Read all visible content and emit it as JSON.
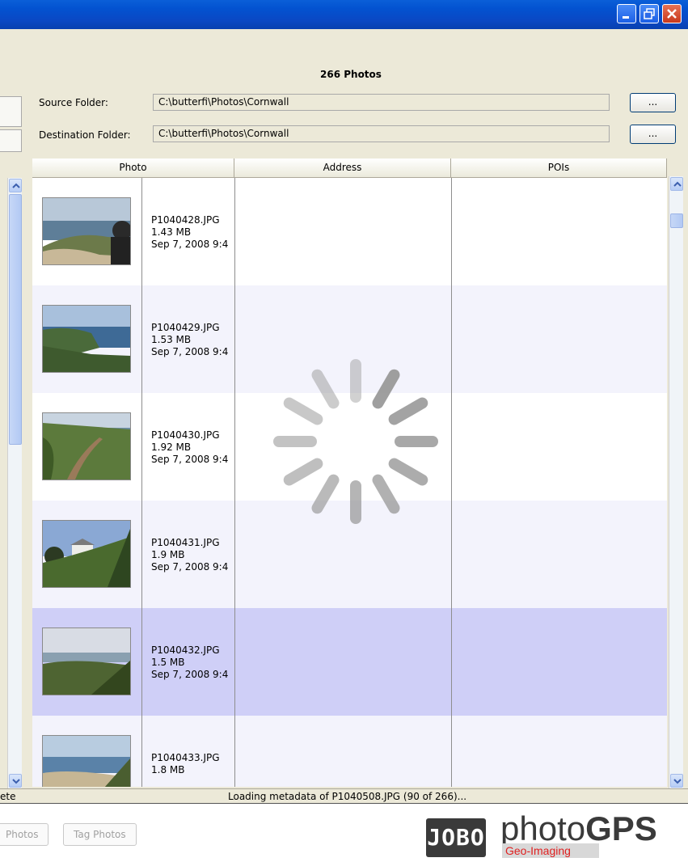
{
  "window": {
    "buttons": [
      "minimize",
      "restore",
      "close"
    ]
  },
  "photo_count": "266 Photos",
  "source": {
    "label": "Source Folder:",
    "value": "C:\\butterfi\\Photos\\Cornwall",
    "browse": "..."
  },
  "destination": {
    "label": "Destination Folder:",
    "value": "C:\\butterfi\\Photos\\Cornwall",
    "browse": "..."
  },
  "table": {
    "headers": [
      "Photo",
      "Address",
      "POIs"
    ],
    "rows": [
      {
        "name": "P1040428.JPG",
        "size": "1.43 MB",
        "date": "Sep 7, 2008 9:4"
      },
      {
        "name": "P1040429.JPG",
        "size": "1.53 MB",
        "date": "Sep 7, 2008 9:4"
      },
      {
        "name": "P1040430.JPG",
        "size": "1.92 MB",
        "date": "Sep 7, 2008 9:4"
      },
      {
        "name": "P1040431.JPG",
        "size": "1.9 MB",
        "date": "Sep 7, 2008 9:4"
      },
      {
        "name": "P1040432.JPG",
        "size": "1.5 MB",
        "date": "Sep 7, 2008 9:4"
      },
      {
        "name": "P1040433.JPG",
        "size": "1.8 MB",
        "date": ""
      }
    ]
  },
  "status": {
    "left": "ete",
    "message": "Loading metadata of P1040508.JPG (90 of 266)..."
  },
  "tabs": [
    "Photos",
    "Tag Photos"
  ],
  "logo": {
    "brand": "JOBO",
    "photo": "photo",
    "gps": "GPS",
    "sub": "Geo-Imaging"
  },
  "colors": {
    "row_alt": "#F3F3FC",
    "row_selected": "#CFCFF7",
    "spinner": "#9A9A9A"
  }
}
